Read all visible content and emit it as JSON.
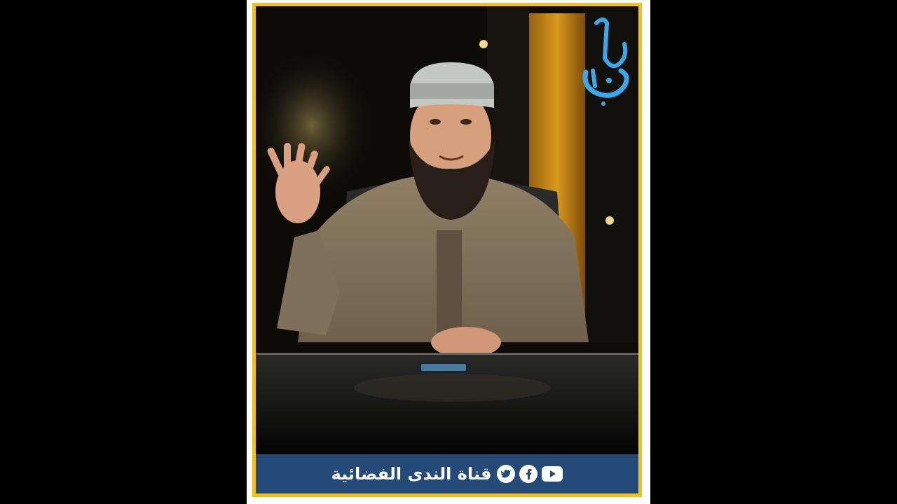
{
  "channel": {
    "footer_text": "قناة الندى الفضائية",
    "logo_text": "الندى"
  },
  "social_icons": [
    "youtube-icon",
    "facebook-icon",
    "twitter-icon"
  ],
  "colors": {
    "frame_border": "#f5c014",
    "footer_bar": "#264a78",
    "logo": "#3aa8e8"
  }
}
